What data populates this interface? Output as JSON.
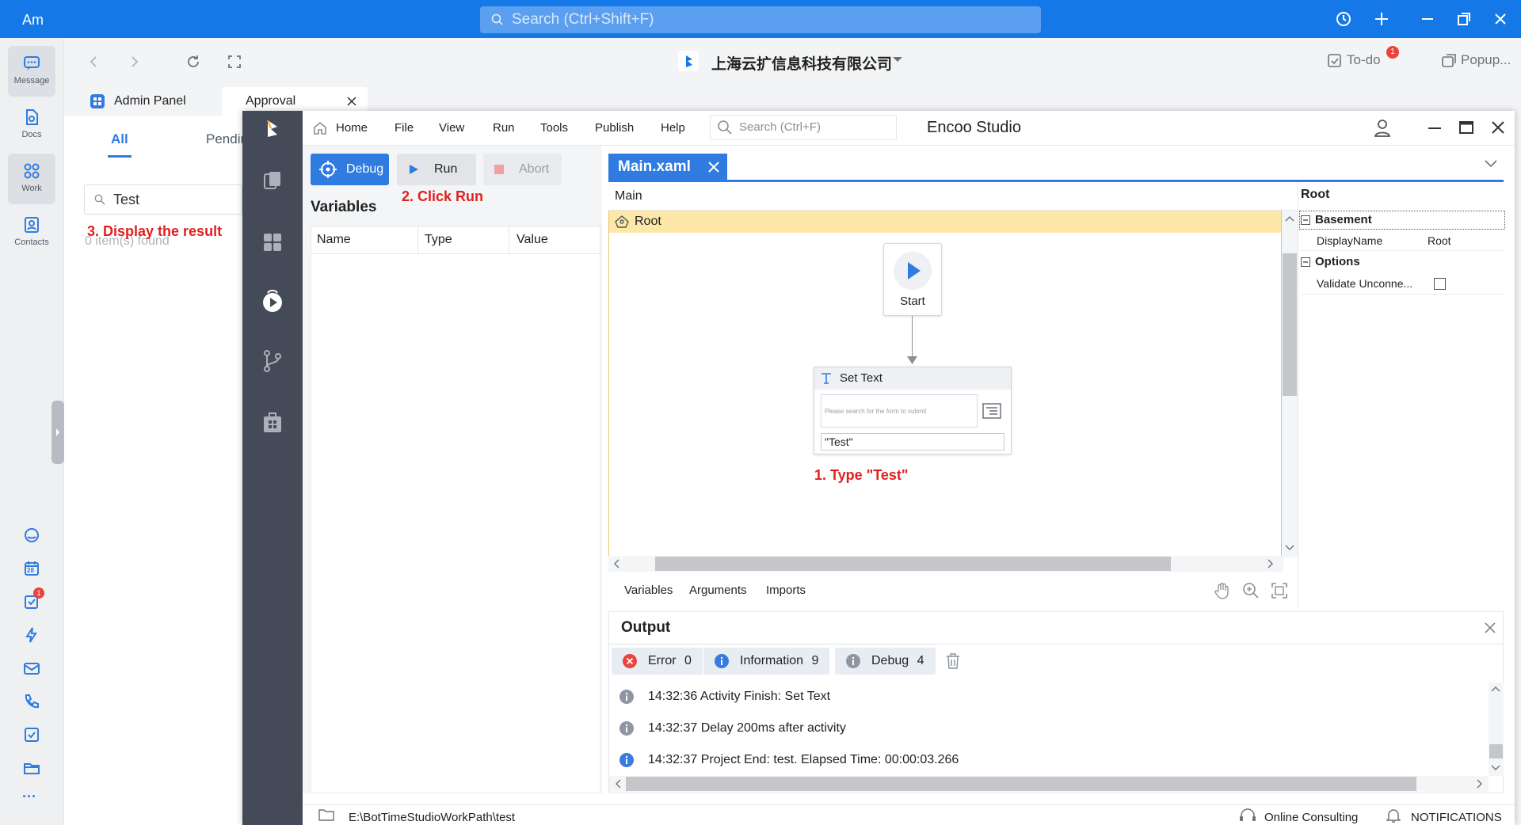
{
  "app": {
    "avatar_text": "Am",
    "search_placeholder": "Search (Ctrl+Shift+F)",
    "company": "上海云扩信息科技有限公司",
    "todo_label": "To-do",
    "todo_badge": "1",
    "popup_label": "Popup...",
    "accent": "#1478e6"
  },
  "rail": {
    "items": [
      {
        "label": "Message"
      },
      {
        "label": "Docs"
      },
      {
        "label": "Work"
      },
      {
        "label": "Contacts"
      }
    ],
    "calendar_day": "28",
    "tasks_badge": "1",
    "more": "···"
  },
  "tabs": [
    {
      "label": "Admin Panel"
    },
    {
      "label": "Approval"
    }
  ],
  "approval": {
    "tab_all": "All",
    "tab_pending": "Pendin",
    "search_value": "Test",
    "result_text": "0 item(s) found"
  },
  "studio": {
    "title": "Encoo Studio",
    "menu": [
      "Home",
      "File",
      "View",
      "Run",
      "Tools",
      "Publish",
      "Help"
    ],
    "search_placeholder": "Search  (Ctrl+F)",
    "buttons": {
      "debug": "Debug",
      "run": "Run",
      "abort": "Abort"
    },
    "variables_title": "Variables",
    "variable_columns": [
      "Name",
      "Type",
      "Value"
    ],
    "doc_tab": "Main.xaml",
    "breadcrumb": "Main",
    "root_label": "Root",
    "start_label": "Start",
    "set_text_title": "Set Text",
    "set_text_placeholder": "Please search for the form to submit",
    "set_text_value": "\"Test\"",
    "designer_tabs": [
      "Variables",
      "Arguments",
      "Imports"
    ],
    "properties": {
      "title": "Root",
      "section_basement": "Basement",
      "display_name_label": "DisplayName",
      "display_name_value": "Root",
      "section_options": "Options",
      "validate_label": "Validate Unconne..."
    },
    "output": {
      "title": "Output",
      "filters": [
        {
          "label": "Error",
          "count": "0",
          "color": "#e8453c"
        },
        {
          "label": "Information",
          "count": "9",
          "color": "#3a7be0"
        },
        {
          "label": "Debug",
          "count": "4",
          "color": "#8f96a3"
        }
      ],
      "logs": [
        {
          "text": "14:32:36 Activity Finish:  Set Text",
          "level": "debug"
        },
        {
          "text": "14:32:37 Delay 200ms after activity",
          "level": "debug"
        },
        {
          "text": "14:32:37 Project End:  test. Elapsed Time:  00:00:03.266",
          "level": "info"
        }
      ]
    },
    "status": {
      "path": "E:\\BotTimeStudioWorkPath\\test",
      "consulting": "Online Consulting",
      "notifications": "NOTIFICATIONS"
    }
  },
  "annotations": {
    "step1": "1. Type \"Test\"",
    "step2": "2. Click Run",
    "step3": "3. Display the result"
  }
}
